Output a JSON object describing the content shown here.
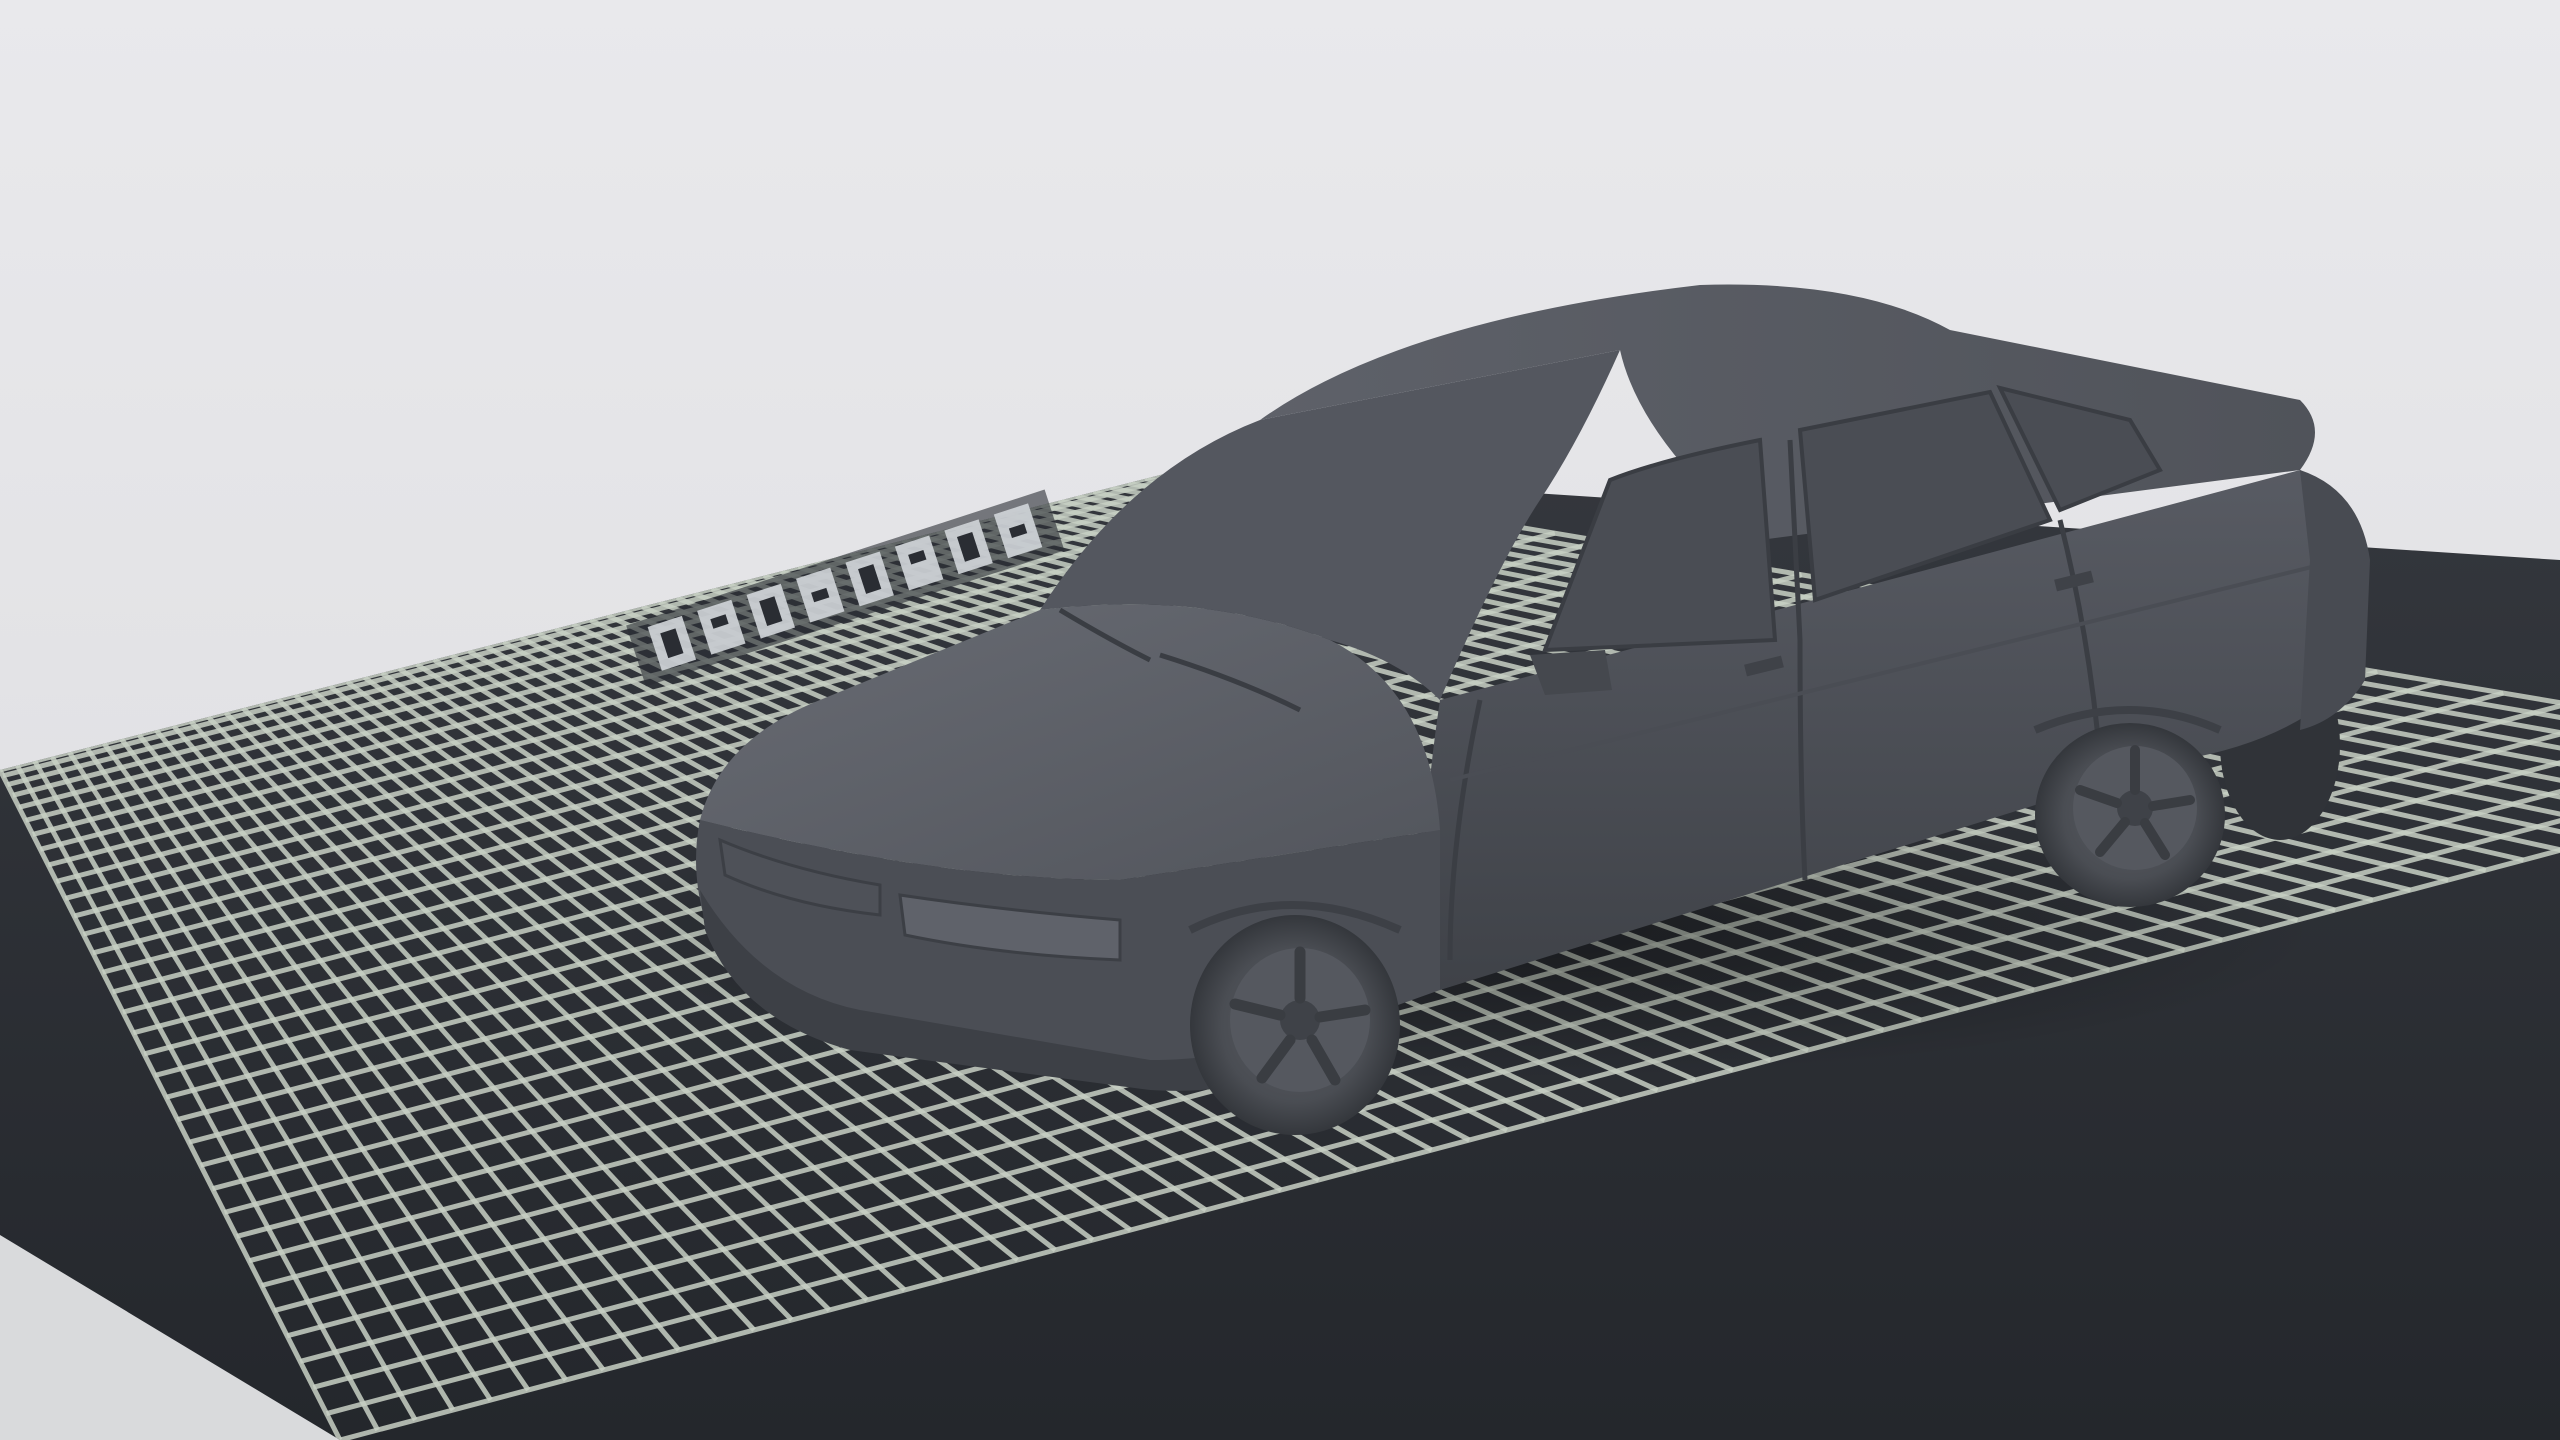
{
  "viewport": {
    "background_color": "#e7e7e9",
    "bed_color": "#2a2d33",
    "grid_color": "#c8d0c4",
    "model_color": "#5b5e66"
  },
  "build_plate": {
    "grid": "on"
  },
  "model": {
    "kind": "sedan-car-3d-model",
    "wheels_visible": 2
  }
}
